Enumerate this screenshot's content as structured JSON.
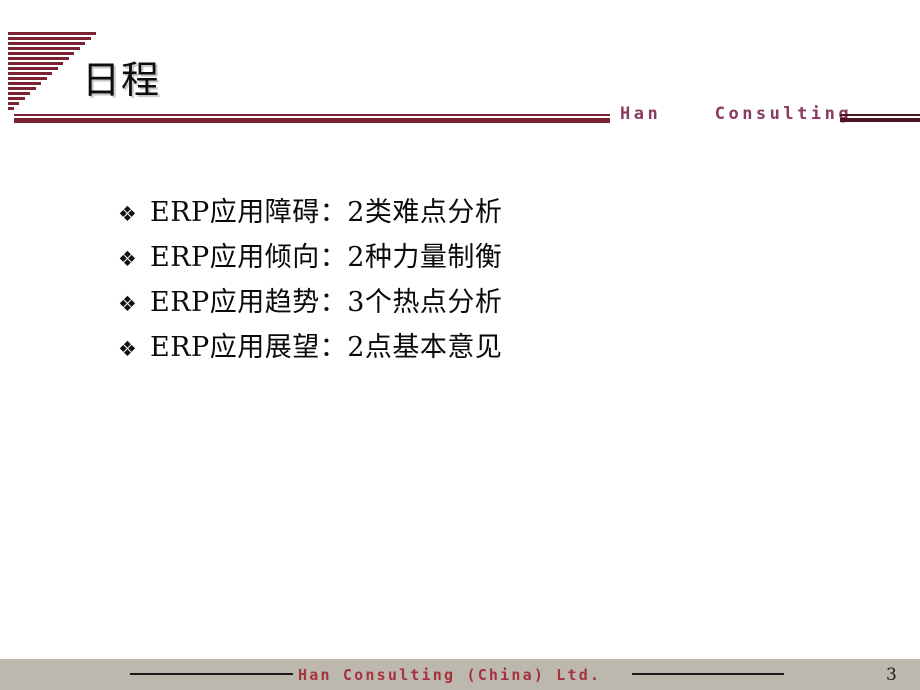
{
  "slide": {
    "page_number": "3",
    "background_color": "#FFFFFF"
  },
  "header": {
    "title": "日程",
    "logo_icon": "striped-triangle-logo",
    "brand_word_1": "Han",
    "brand_word_2": "Consulting",
    "brand_color": "#8B3A62",
    "rule_color": "#7B2233",
    "rule_right_color": "#4A1520"
  },
  "content": {
    "bullet_glyph": "❖",
    "items": [
      {
        "text": "ERP应用障碍：2类难点分析"
      },
      {
        "text": "ERP应用倾向：2种力量制衡"
      },
      {
        "text": "ERP应用趋势：3个热点分析"
      },
      {
        "text": "ERP应用展望：2点基本意见"
      }
    ]
  },
  "footer": {
    "brand": "Han Consulting (China) Ltd.",
    "brand_color": "#A63240",
    "band_color": "#BDB8AE",
    "rule_color": "#1A1A1A",
    "page_number": "3"
  }
}
